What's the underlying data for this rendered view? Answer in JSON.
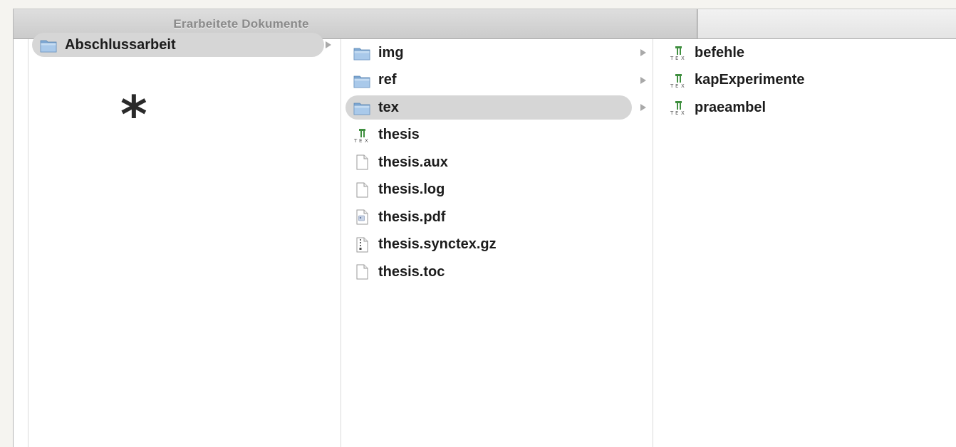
{
  "tabs": [
    {
      "label": "Erarbeitete Dokumente",
      "active": true
    },
    {
      "label": "",
      "active": false
    }
  ],
  "annotation": {
    "symbol": "*"
  },
  "columns": [
    {
      "items": [
        {
          "name": "Abschlussarbeit",
          "icon": "folder-icon",
          "selected": true,
          "has_children": true
        }
      ]
    },
    {
      "items": [
        {
          "name": "img",
          "icon": "folder-icon",
          "selected": false,
          "has_children": true
        },
        {
          "name": "ref",
          "icon": "folder-icon",
          "selected": false,
          "has_children": true
        },
        {
          "name": "tex",
          "icon": "folder-icon",
          "selected": true,
          "has_children": true
        },
        {
          "name": "thesis",
          "icon": "tex-file-icon",
          "selected": false,
          "has_children": false
        },
        {
          "name": "thesis.aux",
          "icon": "document-icon",
          "selected": false,
          "has_children": false
        },
        {
          "name": "thesis.log",
          "icon": "document-icon",
          "selected": false,
          "has_children": false
        },
        {
          "name": "thesis.pdf",
          "icon": "pdf-file-icon",
          "selected": false,
          "has_children": false
        },
        {
          "name": "thesis.synctex.gz",
          "icon": "archive-file-icon",
          "selected": false,
          "has_children": false
        },
        {
          "name": "thesis.toc",
          "icon": "document-icon",
          "selected": false,
          "has_children": false
        }
      ]
    },
    {
      "items": [
        {
          "name": "befehle",
          "icon": "tex-file-icon",
          "selected": false,
          "has_children": false
        },
        {
          "name": "kapExperimente",
          "icon": "tex-file-icon",
          "selected": false,
          "has_children": false
        },
        {
          "name": "praeambel",
          "icon": "tex-file-icon",
          "selected": false,
          "has_children": false
        }
      ]
    }
  ],
  "colors": {
    "selection": "#d6d6d6",
    "folder": "#8fb8e0",
    "text": "#1c1c1c",
    "tab_text": "#8a8a8a"
  }
}
